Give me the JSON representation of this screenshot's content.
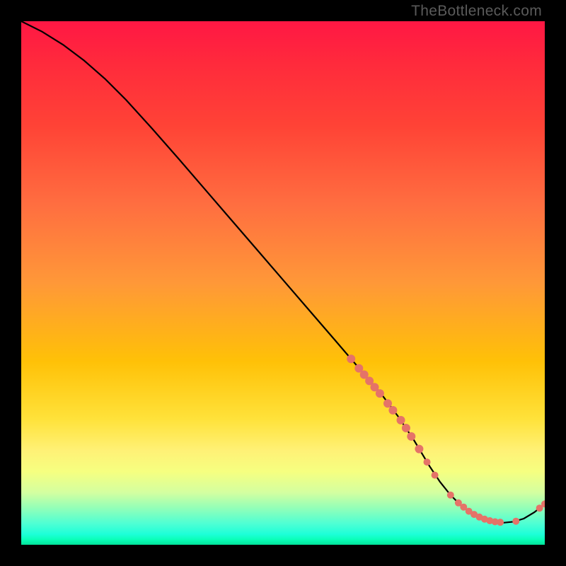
{
  "watermark": "TheBottleneck.com",
  "chart_data": {
    "type": "line",
    "title": "",
    "xlabel": "",
    "ylabel": "",
    "xlim": [
      0,
      100
    ],
    "ylim": [
      0,
      100
    ],
    "grid": false,
    "legend": false,
    "series": [
      {
        "name": "curve",
        "color": "#000000",
        "x": [
          0,
          4,
          8,
          12,
          16,
          20,
          25,
          30,
          35,
          40,
          45,
          50,
          55,
          60,
          63,
          66,
          69,
          72,
          75,
          78,
          80,
          82,
          84,
          86,
          88,
          90,
          92,
          94,
          96,
          98,
          100
        ],
        "y": [
          100,
          98,
          95.5,
          92.5,
          89,
          85,
          79.5,
          73.8,
          68,
          62.2,
          56.4,
          50.6,
          44.8,
          39,
          35.5,
          32,
          28.5,
          24.5,
          20,
          15,
          12,
          9.5,
          7.5,
          6,
          5,
          4.4,
          4.2,
          4.4,
          5,
          6.2,
          7.8
        ]
      }
    ],
    "highlight_points": {
      "color": "#e57368",
      "radius_large": 6,
      "radius_small": 5,
      "points": [
        {
          "x": 63,
          "y": 35.5,
          "r": 6
        },
        {
          "x": 64.5,
          "y": 33.7,
          "r": 6
        },
        {
          "x": 65.5,
          "y": 32.5,
          "r": 6
        },
        {
          "x": 66.5,
          "y": 31.3,
          "r": 6
        },
        {
          "x": 67.5,
          "y": 30.1,
          "r": 6
        },
        {
          "x": 68.5,
          "y": 28.9,
          "r": 6
        },
        {
          "x": 70,
          "y": 27,
          "r": 6
        },
        {
          "x": 71,
          "y": 25.7,
          "r": 6
        },
        {
          "x": 72.5,
          "y": 23.8,
          "r": 6
        },
        {
          "x": 73.5,
          "y": 22.3,
          "r": 6
        },
        {
          "x": 74.5,
          "y": 20.7,
          "r": 6
        },
        {
          "x": 76,
          "y": 18.3,
          "r": 6
        },
        {
          "x": 77.5,
          "y": 15.8,
          "r": 5
        },
        {
          "x": 79,
          "y": 13.3,
          "r": 5
        },
        {
          "x": 82,
          "y": 9.5,
          "r": 5
        },
        {
          "x": 83.5,
          "y": 8,
          "r": 5
        },
        {
          "x": 84.5,
          "y": 7.2,
          "r": 5
        },
        {
          "x": 85.5,
          "y": 6.4,
          "r": 5
        },
        {
          "x": 86.5,
          "y": 5.8,
          "r": 5
        },
        {
          "x": 87.5,
          "y": 5.3,
          "r": 5
        },
        {
          "x": 88.5,
          "y": 4.9,
          "r": 5
        },
        {
          "x": 89.5,
          "y": 4.6,
          "r": 5
        },
        {
          "x": 90.5,
          "y": 4.4,
          "r": 5
        },
        {
          "x": 91.5,
          "y": 4.3,
          "r": 5
        },
        {
          "x": 94.5,
          "y": 4.5,
          "r": 5
        },
        {
          "x": 99,
          "y": 7,
          "r": 5
        },
        {
          "x": 100,
          "y": 7.8,
          "r": 5
        }
      ]
    }
  }
}
